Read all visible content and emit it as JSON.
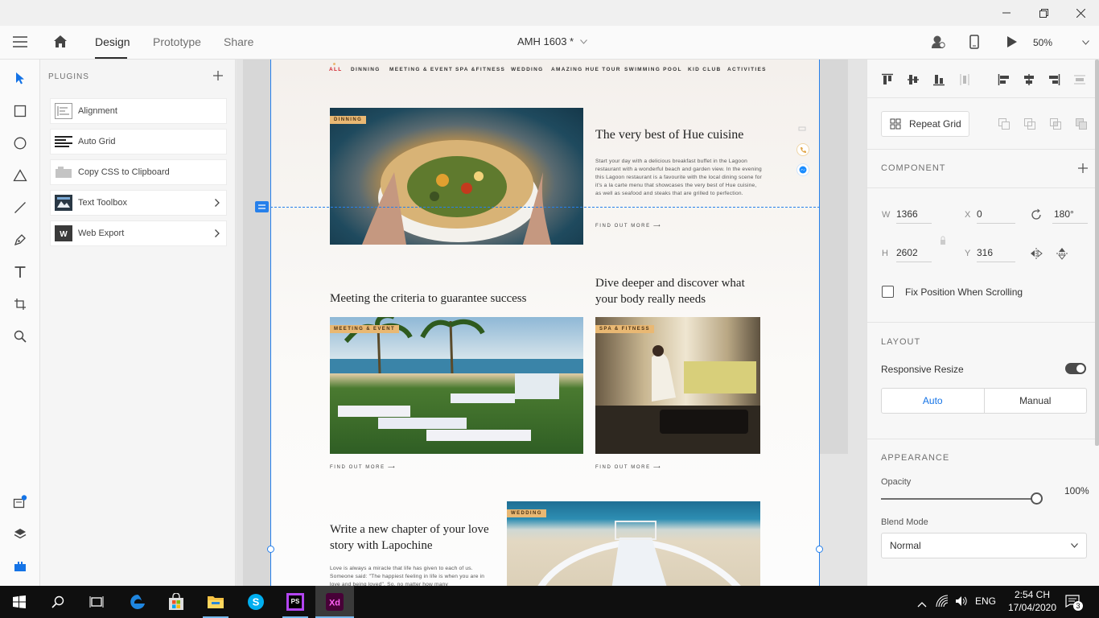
{
  "window": {
    "minimize_icon": "minimize-icon",
    "restore_icon": "restore-icon",
    "close_icon": "close-icon"
  },
  "appbar": {
    "tabs": [
      {
        "label": "Design"
      },
      {
        "label": "Prototype"
      },
      {
        "label": "Share"
      }
    ],
    "document_title": "AMH 1603 *",
    "zoom": "50%"
  },
  "plugins": {
    "header": "PLUGINS",
    "items": [
      {
        "label": "Alignment"
      },
      {
        "label": "Auto Grid"
      },
      {
        "label": "Copy CSS to Clipboard"
      },
      {
        "label": "Text Toolbox"
      },
      {
        "label": "Web Export"
      }
    ]
  },
  "artboard": {
    "nav": [
      "ALL",
      "DINNING",
      "MEETING & EVENT",
      "SPA &FITNESS",
      "WEDDING",
      "AMAZING HUE TOUR",
      "SWIMMING POOL",
      "KID CLUB",
      "ACTIVITIES"
    ],
    "dinning": {
      "tag": "DINNING",
      "title": "The very best of Hue cuisine",
      "body": "Start your day with a delicious breakfast buffet in the Lagoon restaurant with a wonderful beach and garden view. In the evening this Lagoon restaurant is a favourite with the local dining scene for it's a la carte menu that showcases the very best of Hue cuisine, as well as seafood and steaks that are grilled to perfection.",
      "more": "FIND OUT MORE ⟶"
    },
    "meeting": {
      "title": "Meeting the criteria to guarantee success",
      "tag": "MEETING & EVENT",
      "more": "FIND OUT MORE ⟶"
    },
    "spa": {
      "title": "Dive deeper and discover what your body really needs",
      "tag": "SPA & FITNESS",
      "more": "FIND OUT MORE ⟶"
    },
    "wedding": {
      "title": "Write a new chapter of your love story with Lapochine",
      "tag": "WEDDING",
      "body": "Love is always a miracle that life has given to each of us. Someone said: \"The happiest feeling in life is when you are in love and being loved\". So, no matter how many"
    }
  },
  "inspector": {
    "repeat_grid": "Repeat Grid",
    "component_header": "COMPONENT",
    "w_label": "W",
    "w": "1366",
    "x_label": "X",
    "x": "0",
    "rotation": "180°",
    "h_label": "H",
    "h": "2602",
    "y_label": "Y",
    "y": "316",
    "fix_position": "Fix Position When Scrolling",
    "layout_header": "LAYOUT",
    "responsive_resize": "Responsive Resize",
    "auto": "Auto",
    "manual": "Manual",
    "appearance_header": "APPEARANCE",
    "opacity_label": "Opacity",
    "opacity": "100%",
    "opacity_level": 1.0,
    "blend_label": "Blend Mode",
    "blend": "Normal"
  },
  "taskbar": {
    "language": "ENG",
    "time": "2:54 CH",
    "date": "17/04/2020",
    "notifications": "3"
  },
  "colors": {
    "accent": "#2680eb",
    "tag": "#e9b873",
    "xd": "#470137",
    "taskbar": "#0f0f0f"
  }
}
